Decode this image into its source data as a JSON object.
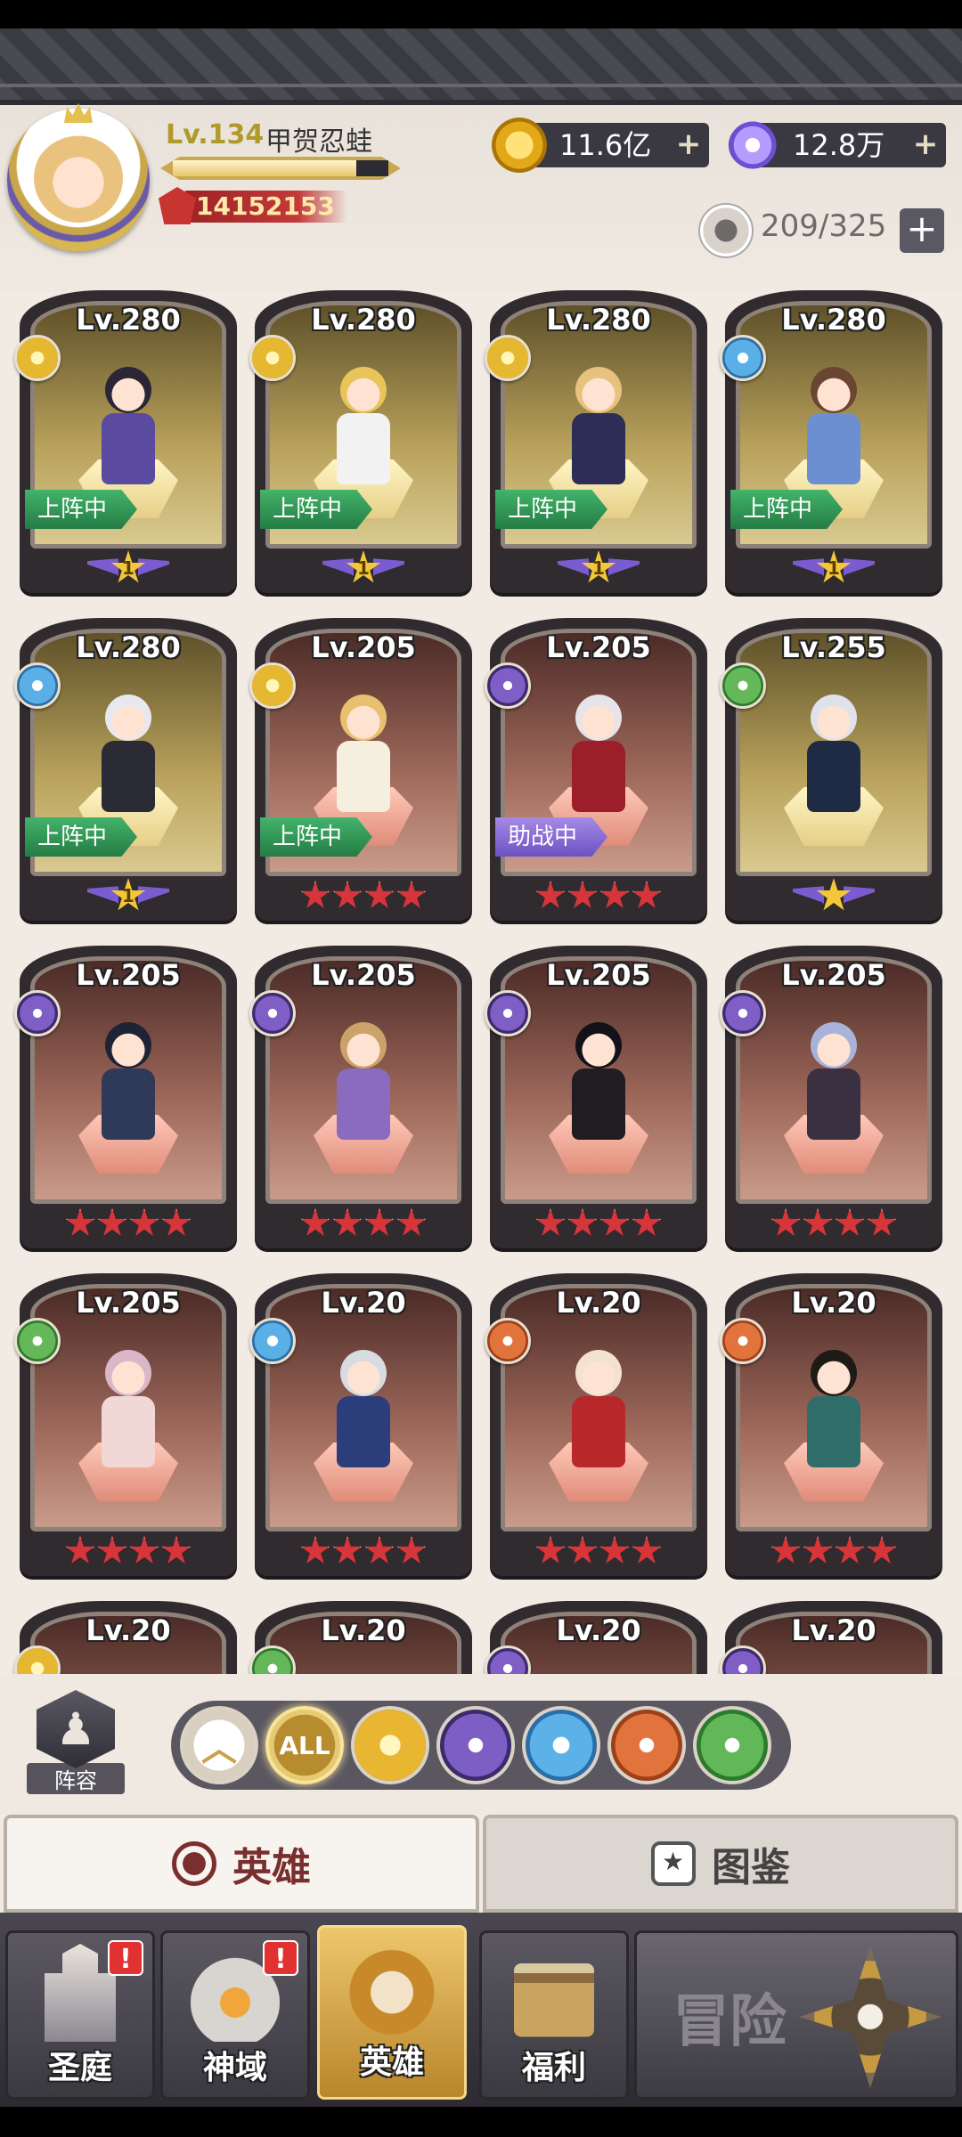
{
  "player": {
    "level": "Lv.134",
    "name": "甲贺忍蛙",
    "exp_fraction": 0.85,
    "power": "14152153"
  },
  "currencies": {
    "gold": "11.6亿",
    "gems": "12.8万"
  },
  "roster": {
    "count": "209/325"
  },
  "heroes": [
    {
      "level": "Lv.280",
      "faction": "light",
      "bg": "gold",
      "status": "上阵中",
      "rank_type": "wing",
      "rank": "1",
      "hair": "#2b2636",
      "outfit": "#5a4aa0"
    },
    {
      "level": "Lv.280",
      "faction": "light",
      "bg": "gold",
      "status": "上阵中",
      "rank_type": "wing",
      "rank": "1",
      "hair": "#e8c45a",
      "outfit": "#f2f2f2"
    },
    {
      "level": "Lv.280",
      "faction": "light",
      "bg": "gold",
      "status": "上阵中",
      "rank_type": "wing",
      "rank": "1",
      "hair": "#e7c27f",
      "outfit": "#2c2e58"
    },
    {
      "level": "Lv.280",
      "faction": "holy",
      "bg": "gold",
      "status": "上阵中",
      "rank_type": "wing",
      "rank": "1",
      "hair": "#6a4632",
      "outfit": "#6c8fd1"
    },
    {
      "level": "Lv.280",
      "faction": "holy",
      "bg": "gold",
      "status": "上阵中",
      "rank_type": "wing",
      "rank": "1",
      "hair": "#e8e8ef",
      "outfit": "#2b2b36"
    },
    {
      "level": "Lv.205",
      "faction": "light",
      "bg": "red",
      "status": "上阵中",
      "rank_type": "red",
      "rank": "4",
      "hair": "#e8c170",
      "outfit": "#f5efe0"
    },
    {
      "level": "Lv.205",
      "faction": "dark",
      "bg": "red",
      "status": "助战中",
      "rank_type": "red",
      "rank": "4",
      "hair": "#e7e3e8",
      "outfit": "#9c1e2a"
    },
    {
      "level": "Lv.255",
      "faction": "nature",
      "bg": "gold",
      "status": "",
      "rank_type": "wing",
      "rank": "",
      "hair": "#dfe2ea",
      "outfit": "#1f2a44"
    },
    {
      "level": "Lv.205",
      "faction": "dark",
      "bg": "red",
      "status": "",
      "rank_type": "red",
      "rank": "4",
      "hair": "#1e2436",
      "outfit": "#2f3a5a"
    },
    {
      "level": "Lv.205",
      "faction": "dark",
      "bg": "red",
      "status": "",
      "rank_type": "red",
      "rank": "4",
      "hair": "#caa26a",
      "outfit": "#8a6bc0"
    },
    {
      "level": "Lv.205",
      "faction": "dark",
      "bg": "red",
      "status": "",
      "rank_type": "red",
      "rank": "4",
      "hair": "#121218",
      "outfit": "#201c22"
    },
    {
      "level": "Lv.205",
      "faction": "dark",
      "bg": "red",
      "status": "",
      "rank_type": "red",
      "rank": "4",
      "hair": "#a9b2d8",
      "outfit": "#3b2f42"
    },
    {
      "level": "Lv.205",
      "faction": "nature",
      "bg": "red",
      "status": "",
      "rank_type": "red",
      "rank": "4",
      "hair": "#d9b6c8",
      "outfit": "#f1d7d6"
    },
    {
      "level": "Lv.20",
      "faction": "holy",
      "bg": "red",
      "status": "",
      "rank_type": "red",
      "rank": "4",
      "hair": "#d7dbe2",
      "outfit": "#2b3d7a"
    },
    {
      "level": "Lv.20",
      "faction": "beast",
      "bg": "red",
      "status": "",
      "rank_type": "red",
      "rank": "4",
      "hair": "#f2e2cf",
      "outfit": "#b8282a"
    },
    {
      "level": "Lv.20",
      "faction": "beast",
      "bg": "red",
      "status": "",
      "rank_type": "red",
      "rank": "4",
      "hair": "#1e1a16",
      "outfit": "#2e6d6a"
    },
    {
      "level": "Lv.20",
      "faction": "light",
      "bg": "red",
      "status": "",
      "rank_type": "red",
      "rank": "4",
      "hair": "#f1a9c6",
      "outfit": "#f1a9c6"
    },
    {
      "level": "Lv.20",
      "faction": "nature",
      "bg": "red",
      "status": "",
      "rank_type": "red",
      "rank": "4",
      "hair": "#d83a3a",
      "outfit": "#7a2a2a"
    },
    {
      "level": "Lv.20",
      "faction": "dark",
      "bg": "red",
      "status": "",
      "rank_type": "red",
      "rank": "4",
      "hair": "#2a2a4a",
      "outfit": "#4a3a7a"
    },
    {
      "level": "Lv.20",
      "faction": "dark",
      "bg": "red",
      "status": "",
      "rank_type": "red",
      "rank": "4",
      "hair": "#e6c04a",
      "outfit": "#3b3a46"
    }
  ],
  "filter": {
    "lineup_label": "阵容",
    "up_label": "︿",
    "all_label": "ALL",
    "factions": [
      "light",
      "dark",
      "holy",
      "beast",
      "nature"
    ]
  },
  "tabs": {
    "heroes": "英雄",
    "codex": "图鉴"
  },
  "nav": {
    "court": "圣庭",
    "realm": "神域",
    "hero": "英雄",
    "welfare": "福利",
    "adventure": "冒险",
    "badge": "!"
  }
}
